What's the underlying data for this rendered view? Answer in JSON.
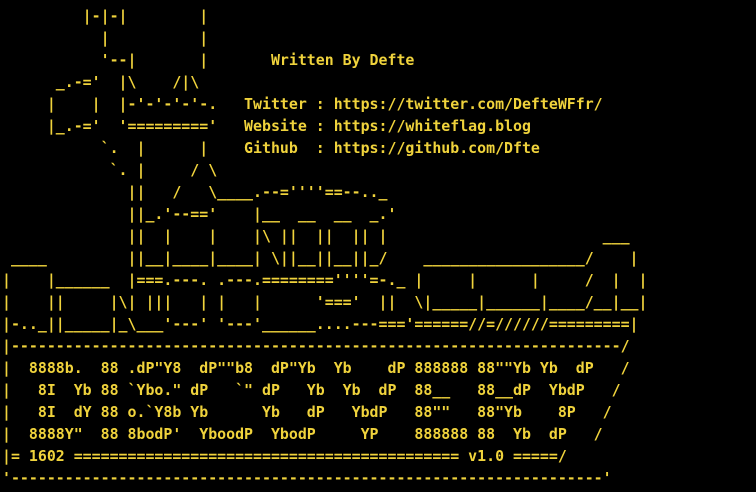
{
  "colors": {
    "background": "#000000",
    "text": "#f0d33c"
  },
  "banner": {
    "lines": [
      "         |-|-|        |",
      "           |          |",
      "           '--|       |       Written By Defte",
      "      _.-='  |\\    /|\\",
      "     |    |  |-'-'-'-'-.   Twitter : https://twitter.com/DefteWFfr/",
      "     |_.-='  '========='   Website : https://whiteflag.blog",
      "           `.  |      |    Github  : https://github.com/Dfte",
      "            `. |     / \\",
      "              ||   /   \\____.--=''''==--.._",
      "              ||_.'--=='    |__  __  __  _.'",
      "              ||  |    |    |\\ ||  ||  || |                        ___",
      " ____         ||__|____|____| \\||__||__||_/    __________________/    |",
      "|    |______  |===.---. .---.========''''=-._ |     |      |     /  |  |",
      "|    ||     |\\| |||   | |   |      '==='  ||  \\|_____|______|____/__|__|",
      "|-.._||_____|_\\___'---' '---'______....---==='======//=//////=========|",
      "|--------------------------------------------------------------------/",
      "|  8888b.  88 .dP\"Y8  dP\"\"b8  dP\"Yb  Yb    dP 888888 88\"\"Yb Yb  dP   /",
      "|   8I  Yb 88 `Ybo.\" dP   `\" dP   Yb  Yb  dP  88__   88__dP  YbdP   /",
      "|   8I  dY 88 o.`Y8b Yb      Yb   dP   YbdP   88\"\"   88\"Yb    8P   /",
      "|  8888Y\"  88 8bodP'  YboodP  YbodP     YP    888888 88  Yb  dP   /",
      "|= 1602 =========================================== v1.0 =====/",
      "'------------------------------------------------------------------'"
    ]
  }
}
